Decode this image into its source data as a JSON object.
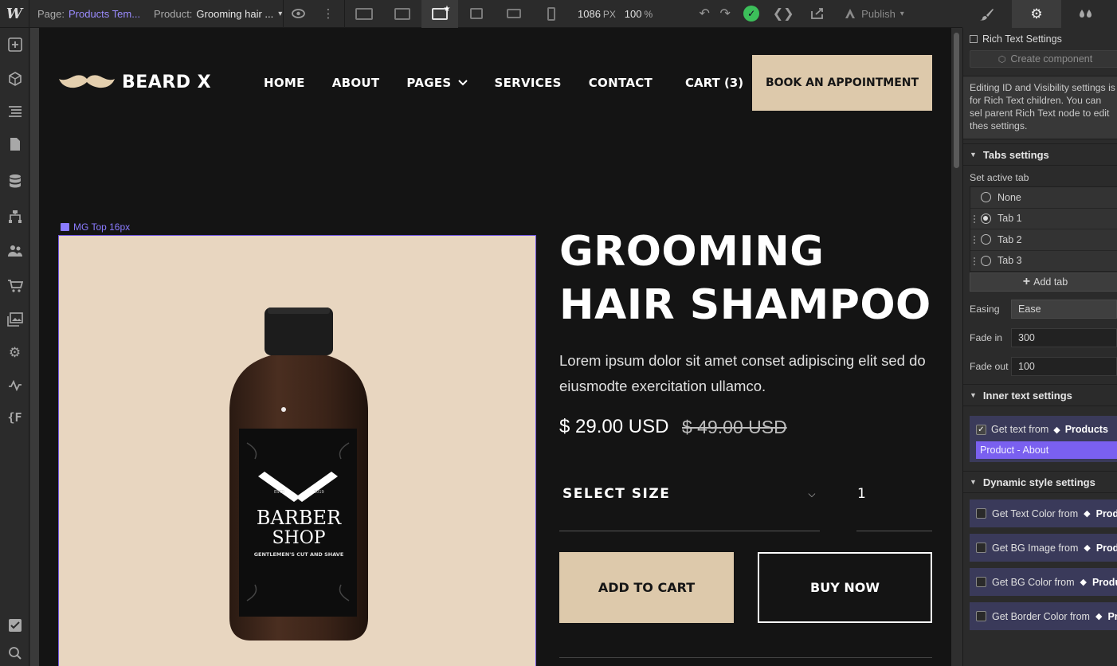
{
  "topbar": {
    "logo": "W",
    "page_label": "Page:",
    "page_value": "Products Tem...",
    "product_label": "Product:",
    "product_value": "Grooming hair ...",
    "width_value": "1086",
    "width_unit": "PX",
    "zoom_value": "100",
    "zoom_unit": "%",
    "publish_label": "Publish"
  },
  "site": {
    "brand": "BEARD X",
    "nav": [
      "HOME",
      "ABOUT",
      "PAGES",
      "SERVICES",
      "CONTACT"
    ],
    "cart": "CART (3)",
    "book_button": "BOOK AN APPOINTMENT",
    "image_tag": "MG Top 16px",
    "product_title": "GROOMING HAIR SHAMPOO",
    "product_desc": "Lorem ipsum dolor sit amet conset adipiscing elit sed do eiusmodte exercitation ullamco.",
    "price": "$ 29.00 USD",
    "old_price": "$ 49.00 USD",
    "select_size": "SELECT SIZE",
    "quantity": "1",
    "add_to_cart": "ADD TO CART",
    "buy_now": "BUY NOW",
    "bottle_label_top": "BARBER",
    "bottle_label_mid": "SHOP",
    "bottle_label_sub": "GENTLEMEN'S CUT AND SHAVE",
    "bottle_year_left": "ESTD",
    "bottle_year_right": "2019"
  },
  "panel": {
    "header": "Rich Text Settings",
    "create_component": "Create component",
    "note": "Editing ID and Visibility settings is for Rich Text children. You can sel parent Rich Text node to edit thes settings.",
    "tabs_section": "Tabs settings",
    "set_active_tab": "Set active tab",
    "tabs": [
      {
        "label": "None",
        "selected": false
      },
      {
        "label": "Tab 1",
        "selected": true
      },
      {
        "label": "Tab 2",
        "selected": false
      },
      {
        "label": "Tab 3",
        "selected": false
      }
    ],
    "add_tab": "Add tab",
    "easing_label": "Easing",
    "easing_value": "Ease",
    "fade_in_label": "Fade in",
    "fade_in_value": "300",
    "fade_out_label": "Fade out",
    "fade_out_value": "100",
    "inner_section": "Inner text settings",
    "get_text_from": "Get text from",
    "products_source": "Products",
    "product_field": "Product - About",
    "dynamic_section": "Dynamic style settings",
    "dynamic_rows": [
      {
        "label": "Get Text Color from",
        "source": "Prod"
      },
      {
        "label": "Get BG Image from",
        "source": "Produ"
      },
      {
        "label": "Get BG Color from",
        "source": "Produ"
      },
      {
        "label": "Get Border Color from",
        "source": "Pr"
      }
    ]
  },
  "colors": {
    "accent": "#ddc9ab",
    "canvas_bg": "#141414",
    "link_purple": "#9b8cff",
    "success": "#3cbf5a",
    "binding_purple": "#7a60f0"
  }
}
